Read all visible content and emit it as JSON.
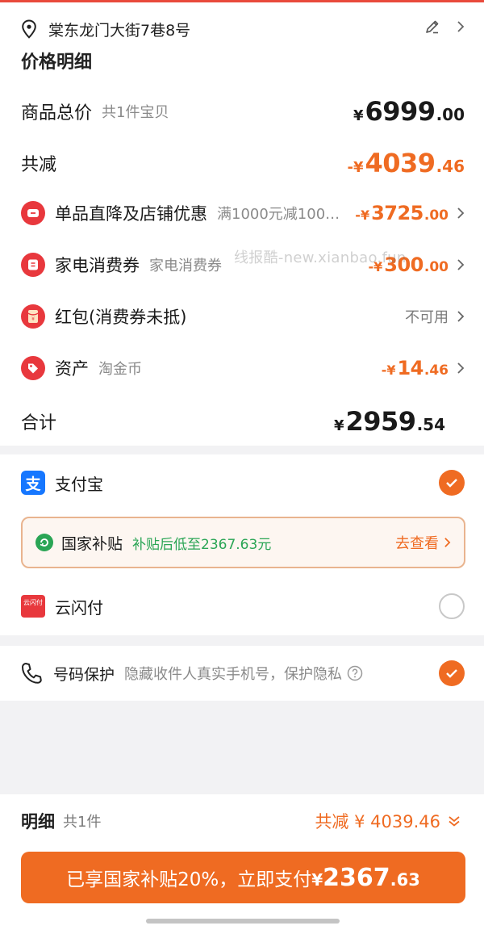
{
  "address": {
    "text": "棠东龙门大街7巷8号"
  },
  "section": {
    "title": "价格明细"
  },
  "goods": {
    "label": "商品总价",
    "sub": "共1件宝贝",
    "currency": "¥",
    "int": "6999",
    "dec": ".00"
  },
  "reduce": {
    "label": "共减",
    "sign": "-¥",
    "int": "4039",
    "dec": ".46"
  },
  "discounts": [
    {
      "label": "单品直降及店铺优惠",
      "sub": "满1000元减100…",
      "sign": "-¥",
      "int": "3725",
      "dec": ".00",
      "icon": "shop-coupon-icon"
    },
    {
      "label": "家电消费券",
      "sub": "家电消费券",
      "sign": "-¥",
      "int": "300",
      "dec": ".00",
      "icon": "voucher-icon"
    },
    {
      "label": "红包(消费券未抵)",
      "sub": "",
      "status": "不可用",
      "icon": "red-packet-icon"
    },
    {
      "label": "资产",
      "sub": "淘金币",
      "sign": "-¥",
      "int": "14",
      "dec": ".46",
      "icon": "tag-icon"
    }
  ],
  "total": {
    "label": "合计",
    "currency": "¥",
    "int": "2959",
    "dec": ".54"
  },
  "watermark": "线报酷-new.xianbao.fun",
  "payment": {
    "alipay": {
      "label": "支付宝",
      "icon_text": "支",
      "selected": true
    },
    "subsidy": {
      "label": "国家补贴",
      "desc": "补贴后低至2367.63元",
      "link": "去查看"
    },
    "unionpay": {
      "label": "云闪付",
      "icon_text": "云闪付",
      "selected": false
    }
  },
  "phone": {
    "label": "号码保护",
    "desc": "隐藏收件人真实手机号，保护隐私",
    "selected": true
  },
  "summary": {
    "label": "明细",
    "count": "共1件",
    "total_text": "共减 ¥ 4039.46"
  },
  "paybutton": {
    "text": "已享国家补贴20%，立即支付",
    "currency": "¥",
    "int": "2367",
    "dec": ".63"
  },
  "colors": {
    "accent": "#ef6b22",
    "red": "#e8383d",
    "green": "#2aa555"
  }
}
